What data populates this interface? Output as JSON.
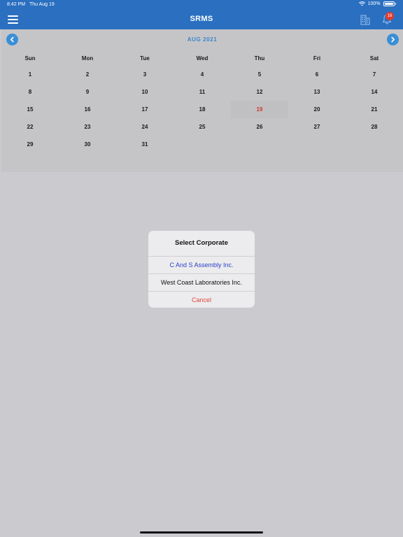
{
  "status_bar": {
    "time": "8:42 PM",
    "date": "Thu Aug 19",
    "battery": "100%"
  },
  "navbar": {
    "title": "SRMS",
    "notification_count": "16"
  },
  "calendar": {
    "month_label": "AUG 2021",
    "weekdays": [
      "Sun",
      "Mon",
      "Tue",
      "Wed",
      "Thu",
      "Fri",
      "Sat"
    ],
    "days": [
      "1",
      "2",
      "3",
      "4",
      "5",
      "6",
      "7",
      "8",
      "9",
      "10",
      "11",
      "12",
      "13",
      "14",
      "15",
      "16",
      "17",
      "18",
      "19",
      "20",
      "21",
      "22",
      "23",
      "24",
      "25",
      "26",
      "27",
      "28",
      "29",
      "30",
      "31",
      "",
      "",
      "",
      ""
    ],
    "today": "19"
  },
  "dialog": {
    "title": "Select Corporate",
    "options": [
      "C And S Assembly Inc.",
      "West Coast Laboratories Inc."
    ],
    "cancel_label": "Cancel"
  },
  "colors": {
    "header": "#2a6fc0",
    "accent": "#3a8fd6",
    "today": "#d0392e",
    "selected_option": "#2b3fc7",
    "cancel": "#e0463a"
  }
}
